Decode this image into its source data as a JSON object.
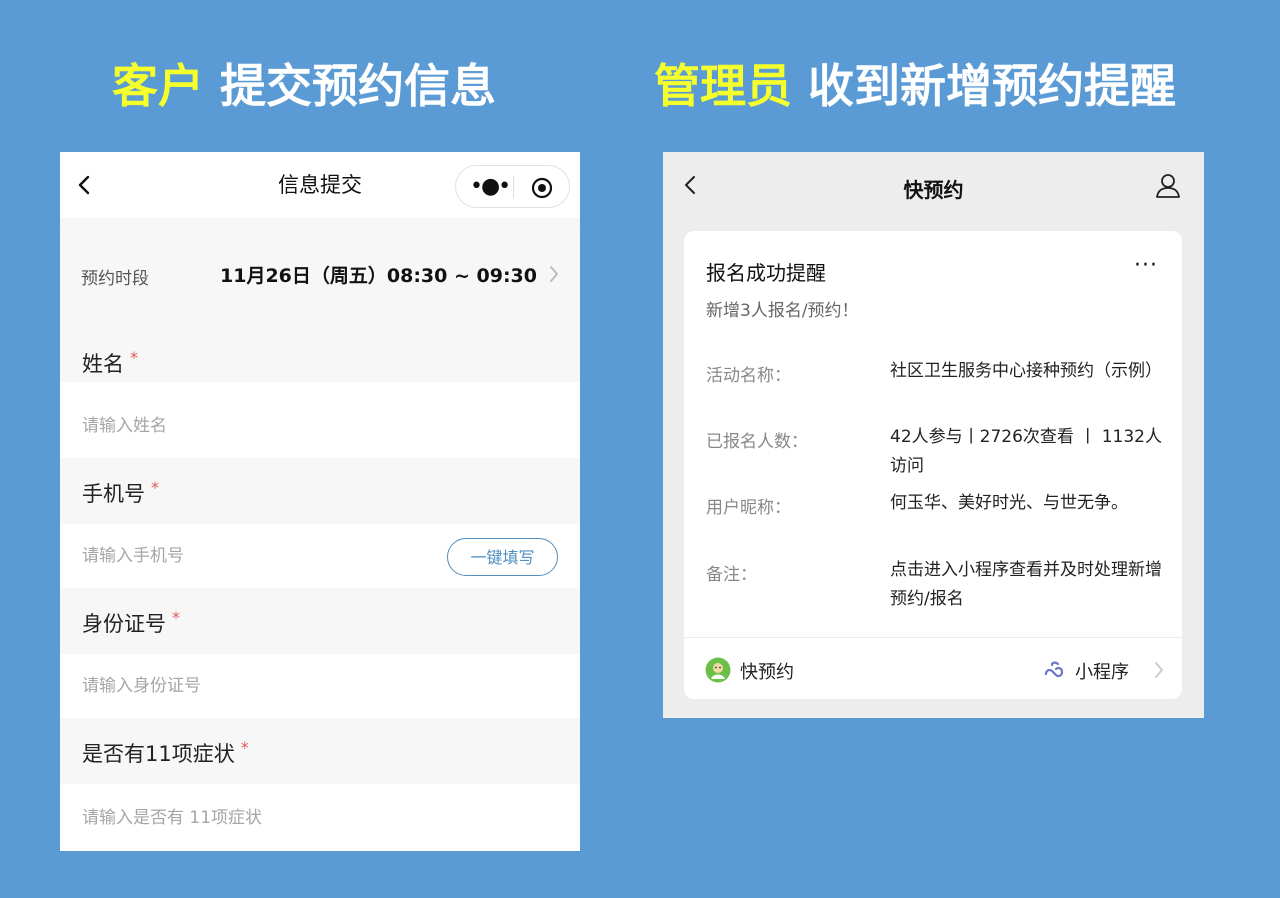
{
  "headings": {
    "left_highlight": "客户",
    "left_rest": " 提交预约信息",
    "right_highlight": "管理员",
    "right_rest": " 收到新增预约提醒"
  },
  "colors": {
    "background": "#5b9bd5",
    "highlight": "#f5ff2b",
    "required": "#e05a5a",
    "accent": "#4f8fc2"
  },
  "form": {
    "nav_title": "信息提交",
    "slot": {
      "label": "预约时段",
      "value": "11月26日（周五）08:30 ~ 09:30"
    },
    "fields": [
      {
        "label": "姓名",
        "required_mark": "*",
        "placeholder": "请输入姓名"
      },
      {
        "label": "手机号",
        "required_mark": "*",
        "placeholder": "请输入手机号"
      },
      {
        "label": "身份证号",
        "required_mark": "*",
        "placeholder": "请输入身份证号"
      },
      {
        "label": "是否有11项症状",
        "required_mark": "*",
        "placeholder": "请输入是否有 11项症状"
      }
    ],
    "fill_button": "一键填写"
  },
  "notice": {
    "nav_title": "快预约",
    "card_title": "报名成功提醒",
    "card_more": "···",
    "card_subtitle": "新增3人报名/预约！",
    "rows": [
      {
        "key": "活动名称：",
        "value": "社区卫生服务中心接种预约（示例）"
      },
      {
        "key": "已报名人数：",
        "value": "42人参与丨2726次查看 丨 1132人访问"
      },
      {
        "key": "用户昵称：",
        "value": "何玉华、美好时光、与世无争。"
      },
      {
        "key": "备注：",
        "value": "点击进入小程序查看并及时处理新增预约/报名"
      }
    ],
    "footer_app": "快预约",
    "footer_type": "小程序"
  }
}
